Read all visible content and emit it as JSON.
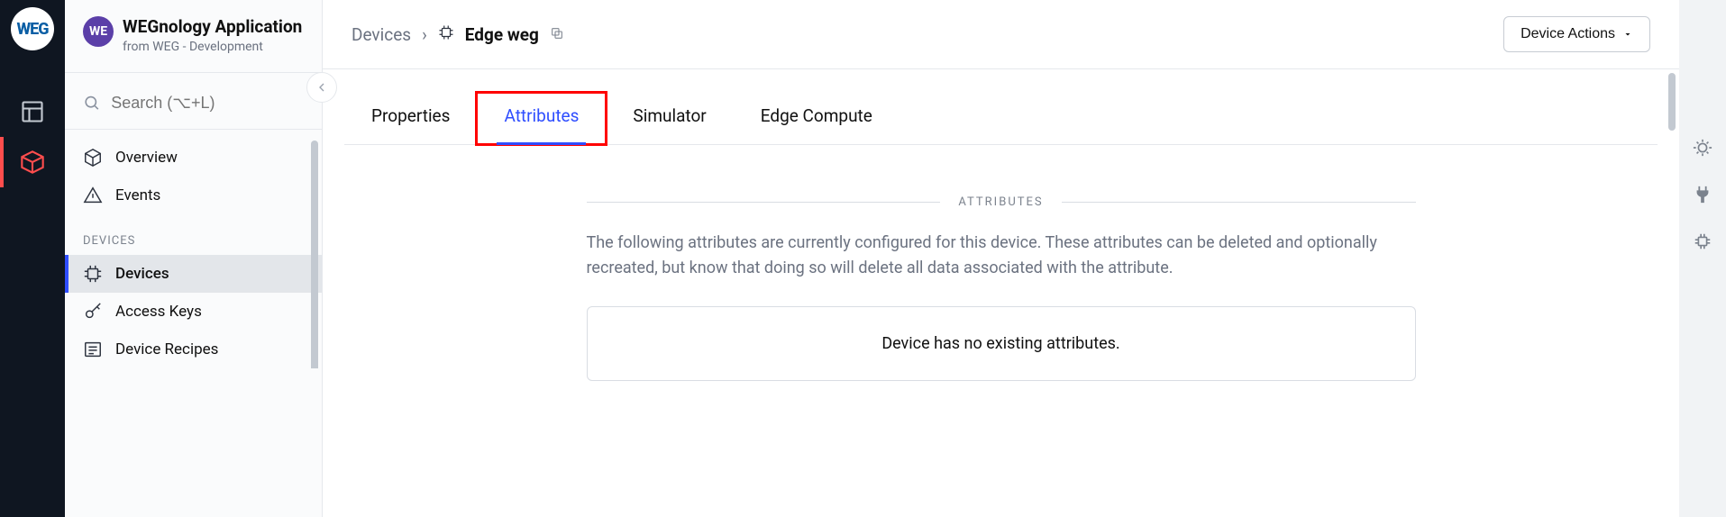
{
  "logo_text": "WEG",
  "app": {
    "badge": "WE",
    "title": "WEGnology Application",
    "subtitle": "from WEG - Development"
  },
  "search": {
    "placeholder": "Search (⌥+L)"
  },
  "nav": {
    "overview": "Overview",
    "events": "Events",
    "heading_devices": "DEVICES",
    "devices": "Devices",
    "access_keys": "Access Keys",
    "device_recipes": "Device Recipes"
  },
  "breadcrumb": {
    "root": "Devices",
    "current": "Edge weg"
  },
  "actions_label": "Device Actions",
  "tabs": {
    "properties": "Properties",
    "attributes": "Attributes",
    "simulator": "Simulator",
    "edge_compute": "Edge Compute"
  },
  "section": {
    "heading": "ATTRIBUTES",
    "description": "The following attributes are currently configured for this device. These attributes can be deleted and optionally recreated, but know that doing so will delete all data associated with the attribute.",
    "empty": "Device has no existing attributes."
  }
}
